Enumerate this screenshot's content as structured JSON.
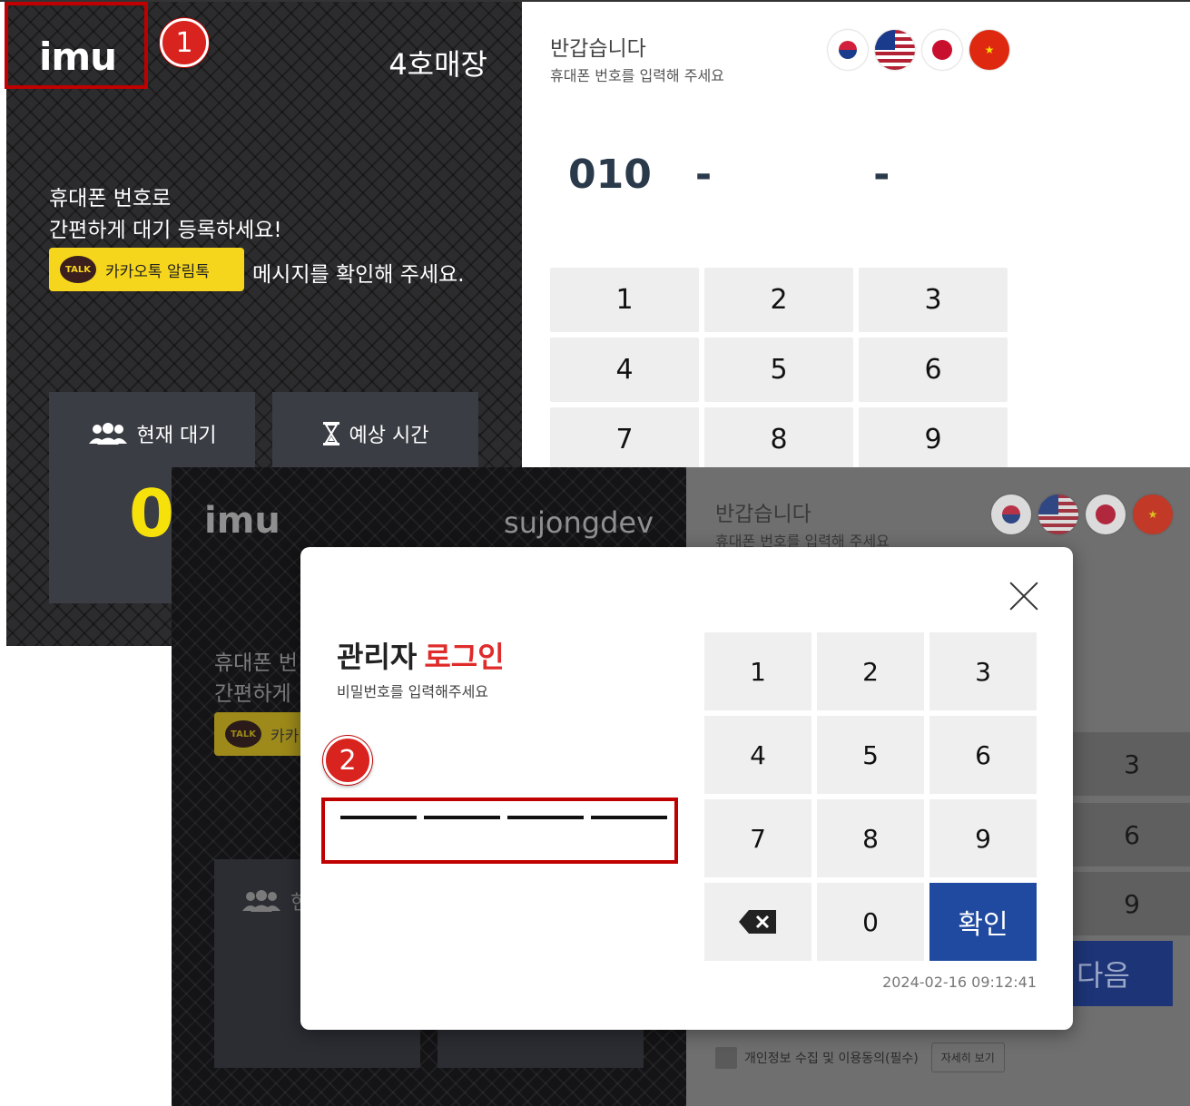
{
  "screen1": {
    "logo": "imu",
    "store_name": "4호매장",
    "intro_line1": "휴대폰 번호로",
    "intro_line2": "간편하게 대기 등록하세요!",
    "kakao_badge": "TALK",
    "kakao_label": "카카오톡 알림톡",
    "kakao_msg": "메시지를 확인해 주세요.",
    "current_wait_label": "현재 대기",
    "current_wait_count": "0",
    "expected_time_label": "예상 시간",
    "greeting": "반갑습니다",
    "subtitle": "휴대폰 번호를 입력해 주세요",
    "phone_prefix": "010",
    "phone_dash": "-",
    "keypad": [
      "1",
      "2",
      "3",
      "4",
      "5",
      "6",
      "7",
      "8",
      "9"
    ],
    "flags": [
      "korea-flag-icon",
      "usa-uk-flag-icon",
      "japan-flag-icon",
      "china-flag-icon"
    ]
  },
  "screen2": {
    "logo": "imu",
    "store_name": "sujongdev",
    "intro_line1": "휴대폰 번",
    "intro_line2": "간편하게",
    "kakao_badge": "TALK",
    "kakao_label": "카카",
    "current_wait_label": "현",
    "greeting": "반갑습니다",
    "subtitle": "휴대폰 번호를 입력해 주세요",
    "side_keys": [
      "3",
      "6",
      "9"
    ],
    "next_label": "다음",
    "consent_text": "개인정보 수집 및 이용동의(필수)",
    "details_label": "자세히 보기"
  },
  "modal": {
    "title_main": "관리자",
    "title_accent": "로그인",
    "subtitle": "비밀번호를 입력해주세요",
    "keys": [
      "1",
      "2",
      "3",
      "4",
      "5",
      "6",
      "7",
      "8",
      "9"
    ],
    "zero": "0",
    "confirm": "확인",
    "timestamp": "2024-02-16 09:12:41"
  },
  "annotations": {
    "badge1": "1",
    "badge2": "2"
  },
  "colors": {
    "kakao": "#f6d61c",
    "accent_red": "#e02b2b",
    "confirm_blue": "#1f4aa0",
    "count_yellow": "#f6e20a",
    "annotation_red": "#c00000"
  }
}
